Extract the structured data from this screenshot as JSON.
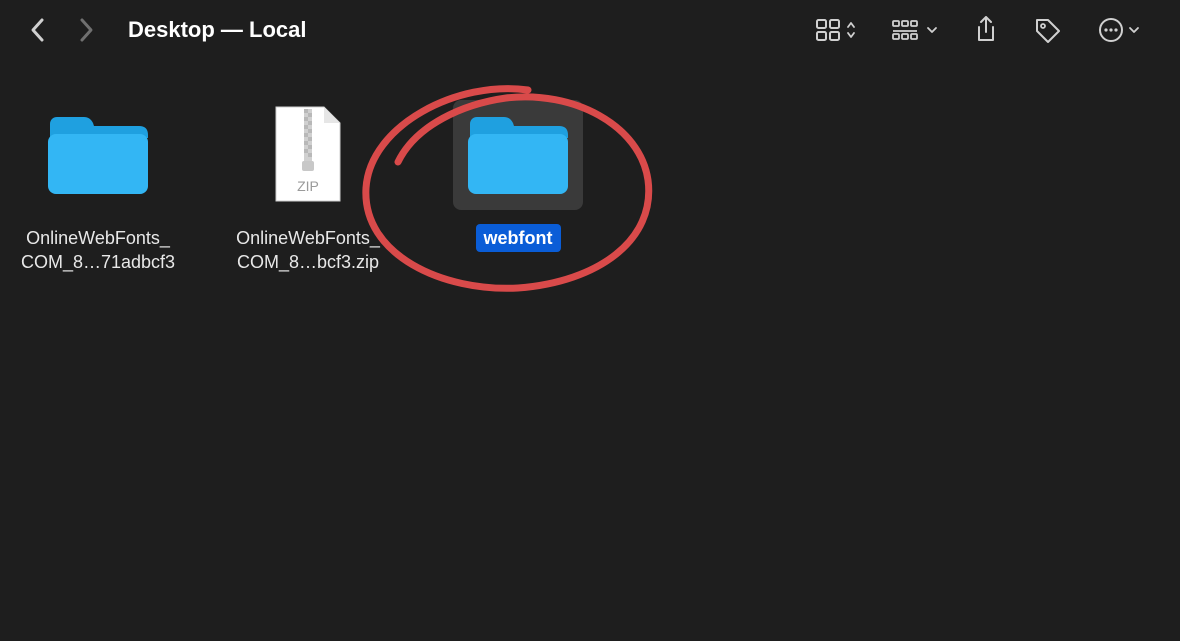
{
  "window": {
    "title": "Desktop — Local"
  },
  "toolbar_icons": {
    "back": "back-chevron",
    "forward": "forward-chevron",
    "view_switch": "grid-view-toggle",
    "group": "group-toggle",
    "share": "share",
    "tags": "tag",
    "more": "more-ellipsis"
  },
  "items": [
    {
      "type": "folder",
      "label_line1": "OnlineWebFonts_",
      "label_line2": "COM_8…71adbcf3",
      "selected": false
    },
    {
      "type": "zip",
      "zip_badge": "ZIP",
      "label_line1": "OnlineWebFonts_",
      "label_line2": "COM_8…bcf3.zip",
      "selected": false
    },
    {
      "type": "folder",
      "label": "webfont",
      "selected": true
    }
  ],
  "annotation": {
    "type": "circle",
    "color": "#d94a4a",
    "target": "webfont"
  },
  "colors": {
    "bg": "#1e1e1e",
    "folder": "#33b6f4",
    "folder_tab": "#1fa0e0",
    "selection_bg": "#3a3a3a",
    "selection_label": "#0a5dd7",
    "annotation": "#d94a4a"
  }
}
